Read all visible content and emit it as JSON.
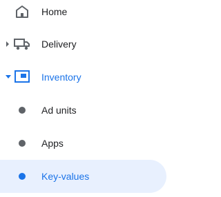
{
  "nav": {
    "items": [
      {
        "label": "Home",
        "icon": "home-icon"
      },
      {
        "label": "Delivery",
        "icon": "truck-icon",
        "expand_state": "collapsed"
      },
      {
        "label": "Inventory",
        "icon": "inventory-icon",
        "expand_state": "expanded"
      },
      {
        "label": "Ad units",
        "icon": "dot-icon"
      },
      {
        "label": "Apps",
        "icon": "dot-icon"
      },
      {
        "label": "Key-values",
        "icon": "dot-icon",
        "selected": true
      }
    ]
  },
  "colors": {
    "text": "#202124",
    "icon": "#5f6368",
    "accent": "#1a73e8",
    "selected_bg": "#e8f0fe"
  }
}
